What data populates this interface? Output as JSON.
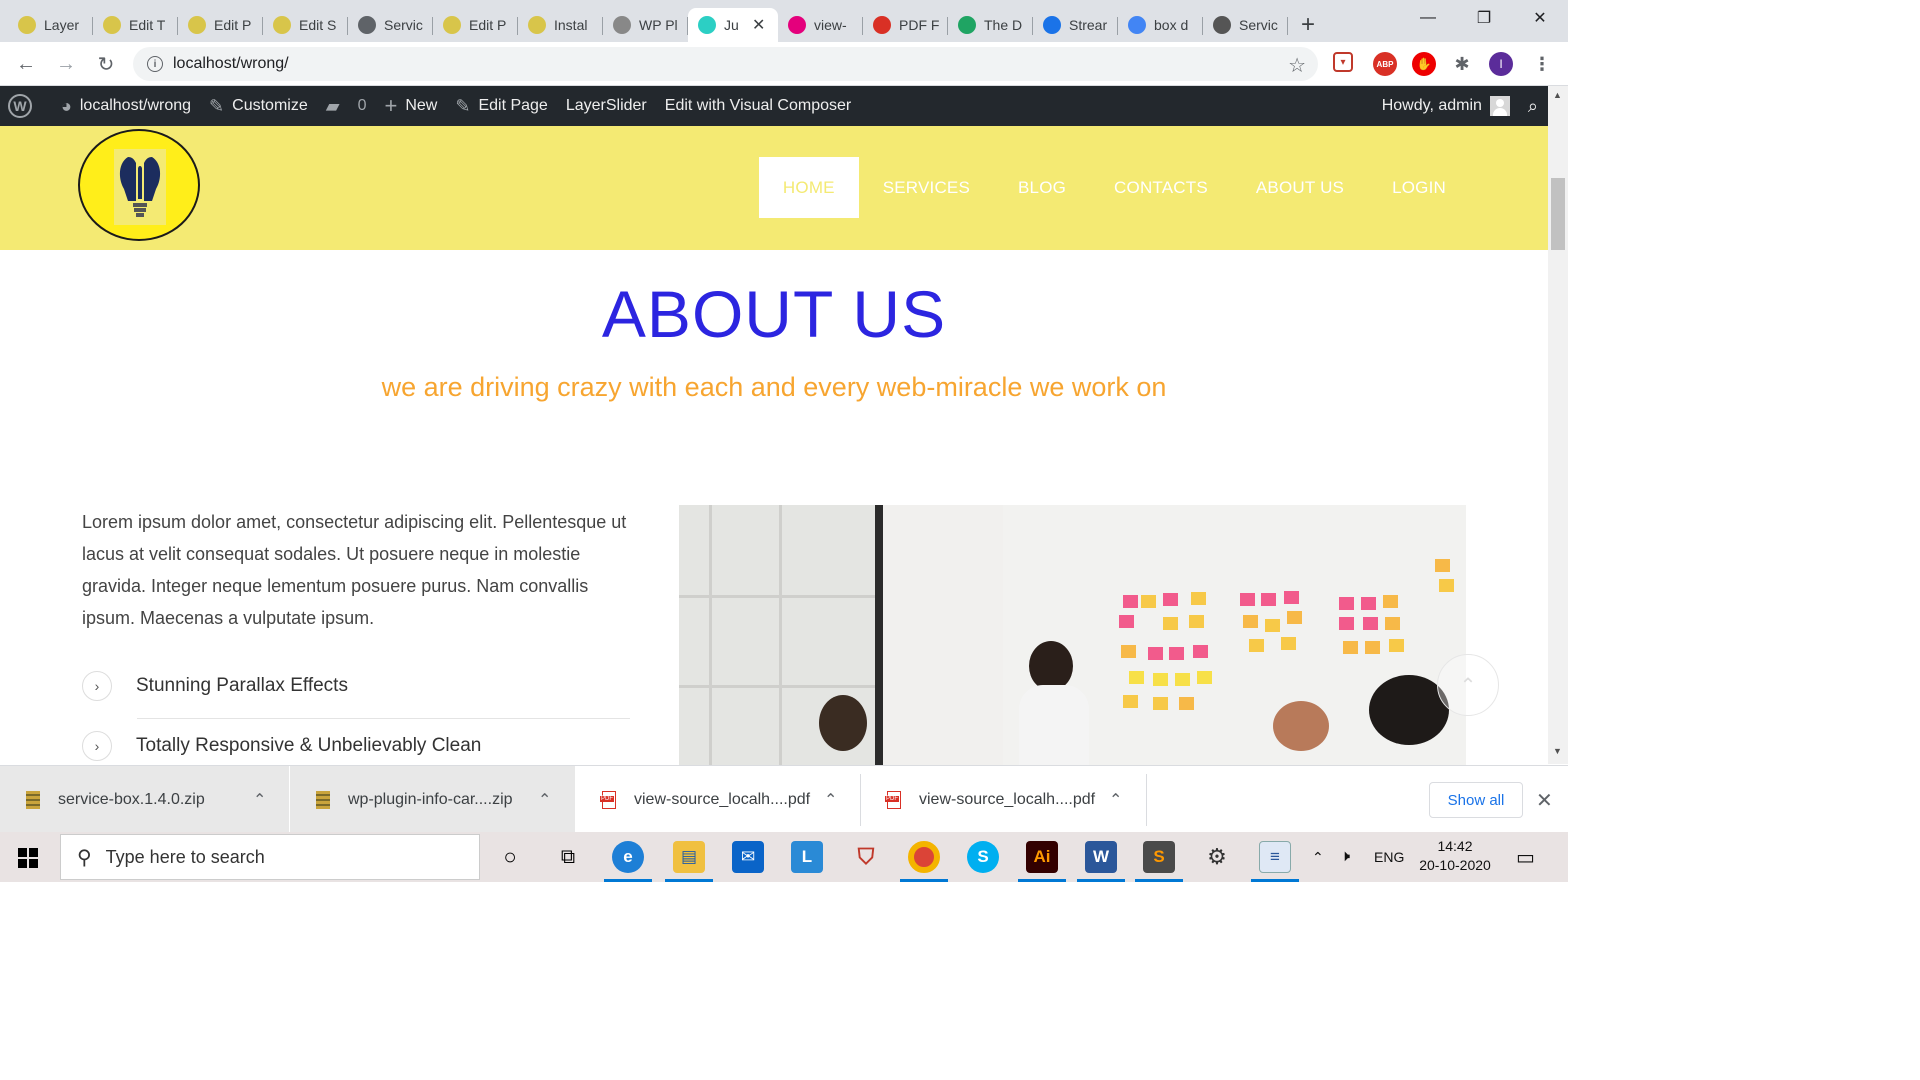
{
  "browser": {
    "tabs": [
      {
        "label": "Layer",
        "favicon": "bulb-favicon",
        "color": "#d8c54a"
      },
      {
        "label": "Edit T",
        "favicon": "bulb-favicon",
        "color": "#d8c54a"
      },
      {
        "label": "Edit P",
        "favicon": "bulb-favicon",
        "color": "#d8c54a"
      },
      {
        "label": "Edit S",
        "favicon": "bulb-favicon",
        "color": "#d8c54a"
      },
      {
        "label": "Servic",
        "favicon": "globe-favicon",
        "color": "#5f6368"
      },
      {
        "label": "Edit P",
        "favicon": "bulb-favicon",
        "color": "#d8c54a"
      },
      {
        "label": "Instal",
        "favicon": "bulb-favicon",
        "color": "#d8c54a"
      },
      {
        "label": "WP Pl",
        "favicon": "wp-plugin-favicon",
        "color": "#888888"
      },
      {
        "label": "Ju",
        "favicon": "ac-favicon",
        "color": "#2ccfc4",
        "active": true
      },
      {
        "label": "view-",
        "favicon": "view-favicon",
        "color": "#e4007c"
      },
      {
        "label": "PDF F",
        "favicon": "gmail-favicon",
        "color": "#d93025"
      },
      {
        "label": "The D",
        "favicon": "drive-favicon",
        "color": "#1fa463"
      },
      {
        "label": "Strear",
        "favicon": "stream-favicon",
        "color": "#1a73e8"
      },
      {
        "label": "box d",
        "favicon": "google-favicon",
        "color": "#4285f4"
      },
      {
        "label": "Servic",
        "favicon": "wordpress-favicon",
        "color": "#555555"
      }
    ],
    "url": "localhost/wrong/"
  },
  "adminbar": {
    "site": "localhost/wrong",
    "customize": "Customize",
    "comments_count": "0",
    "new": "New",
    "edit_page": "Edit Page",
    "layerslider": "LayerSlider",
    "visual_composer": "Edit with Visual Composer",
    "howdy": "Howdy, admin"
  },
  "site": {
    "nav": [
      "HOME",
      "SERVICES",
      "BLOG",
      "CONTACTS",
      "ABOUT US",
      "LOGIN"
    ],
    "title": "ABOUT US",
    "subtitle": "we are driving crazy with each and every web-miracle we work on",
    "intro": "Lorem ipsum dolor amet, consectetur adipiscing elit. Pellentesque ut lacus at velit consequat sodales. Ut posuere neque in molestie gravida. Integer neque lementum posuere purus. Nam convallis ipsum. Maecenas a vulputate ipsum.",
    "features": [
      "Stunning Parallax Effects",
      "Totally Responsive & Unbelievably Clean"
    ],
    "colors": {
      "header": "#f4ea73",
      "title": "#2c25e0",
      "subtitle": "#f7a530"
    }
  },
  "downloads": {
    "items": [
      "service-box.1.4.0.zip",
      "wp-plugin-info-car....zip",
      "view-source_localh....pdf",
      "view-source_localh....pdf"
    ],
    "show_all": "Show all"
  },
  "taskbar": {
    "search_placeholder": "Type here to search",
    "language": "ENG",
    "time": "14:42",
    "date": "20-10-2020"
  }
}
